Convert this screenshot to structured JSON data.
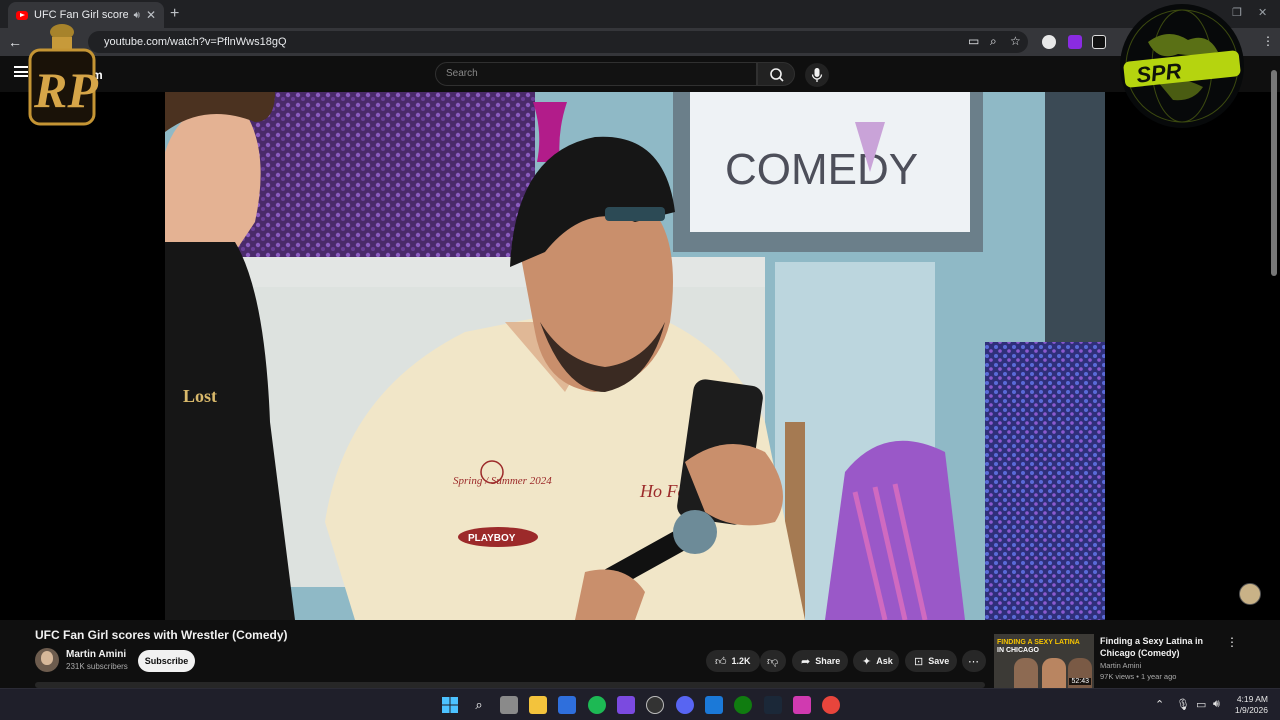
{
  "browser": {
    "tab_title": "UFC Fan Girl scores with W",
    "tab_sound_icon": "speaker-icon",
    "close_glyph": "✕",
    "new_tab_glyph": "+",
    "url": "youtube.com/watch?v=PflnWws18gQ"
  },
  "youtube": {
    "logo_text": "m",
    "search_placeholder": "Search"
  },
  "overlays": {
    "left_logo_text": "RP",
    "right_logo_text": "SPR"
  },
  "video": {
    "title": "UFC Fan Girl scores with Wrestler (Comedy)",
    "channel_name": "Martin Amini",
    "subscribers": "231K subscribers",
    "subscribe_label": "Subscribe",
    "likes": "1.2K",
    "share_label": "Share",
    "ask_label": "Ask",
    "save_label": "Save",
    "scene_text": {
      "sign": "COMEDY",
      "shirt_line1": "Spring / Summer 2024",
      "shirt_brand": "PLAYBOY",
      "shirt_side": "Ho Fem",
      "tshirt": "Lost"
    }
  },
  "recommendation": {
    "thumb_line1": "FINDING A SEXY LATINA",
    "thumb_line2": "IN CHICAGO",
    "duration": "52:43",
    "title": "Finding a Sexy Latina in Chicago (Comedy)",
    "channel": "Martin Amini",
    "meta": "97K views • 1 year ago"
  },
  "taskbar": {
    "time": "4:19 AM",
    "date": "1/9/2026"
  },
  "colors": {
    "background": "#0f0f0f",
    "chrome_dark": "#202124",
    "chrome_mid": "#35363a",
    "yt_red": "#ff0000",
    "scene_purple": "#6a3b8a",
    "scene_teal": "#7fb7c4"
  }
}
